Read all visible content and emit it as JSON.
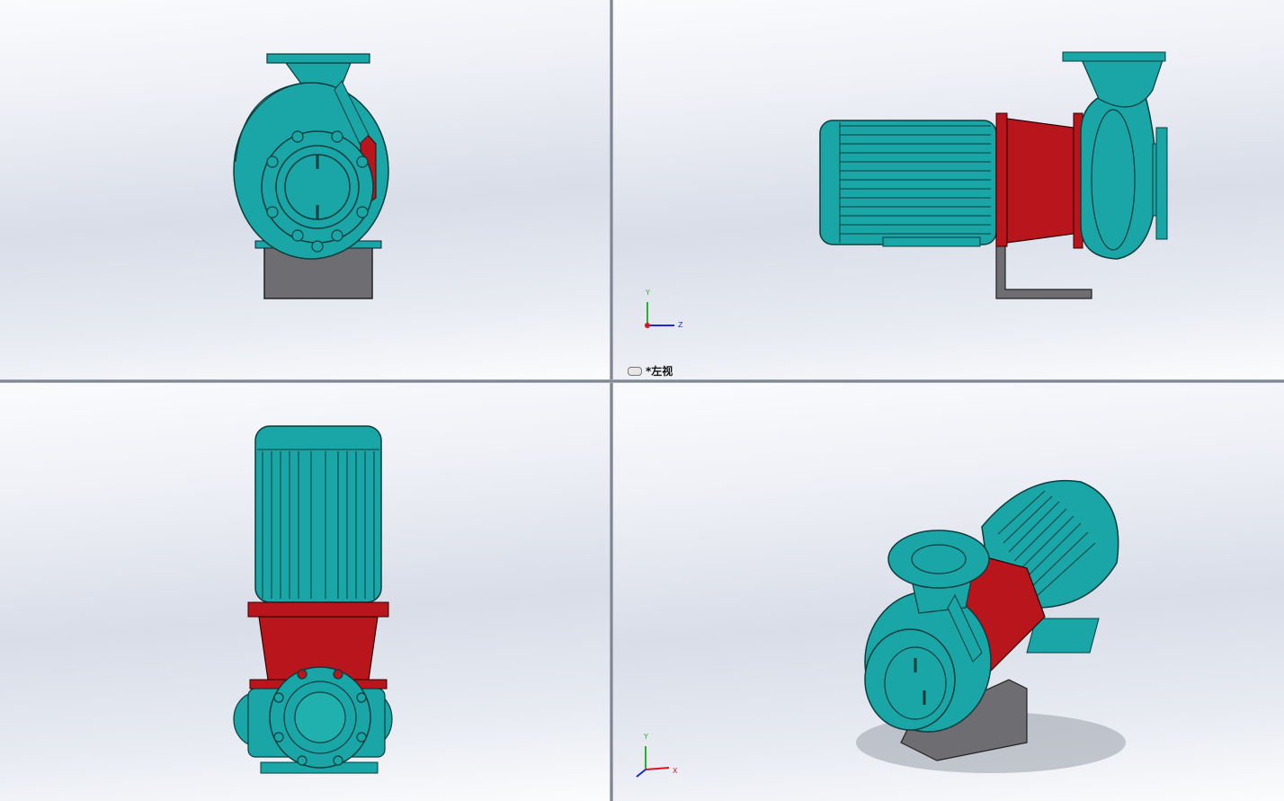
{
  "viewports": {
    "top_right": {
      "view_label": "*左视",
      "triad": {
        "y_label": "Y",
        "z_label": "Z"
      }
    },
    "bottom_right": {
      "triad": {
        "y_label": "Y",
        "x_label": "X"
      }
    }
  },
  "colors": {
    "pump_teal": "#1aa6a6",
    "adapter_red": "#b8161c",
    "bracket_gray": "#6e6e72",
    "background_light": "#f4f5f9"
  }
}
